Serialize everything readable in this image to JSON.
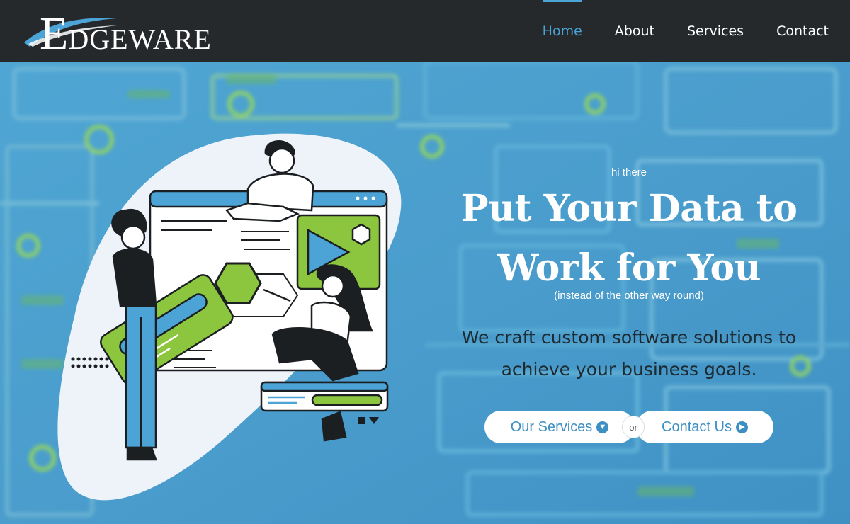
{
  "brand": {
    "logo_initial": "E",
    "logo_rest": "DGEWARE"
  },
  "nav": {
    "items": [
      {
        "label": "Home",
        "active": true
      },
      {
        "label": "About",
        "active": false
      },
      {
        "label": "Services",
        "active": false
      },
      {
        "label": "Contact",
        "active": false
      }
    ]
  },
  "hero": {
    "eyebrow": "hi there",
    "headline_line1": "Put Your Data to",
    "headline_line2": "Work for You",
    "sub_note": "(instead of the other way round)",
    "lead_line1": "We craft custom software solutions to",
    "lead_line2": "achieve your business goals.",
    "cta_primary": "Our Services",
    "cta_divider": "or",
    "cta_secondary": "Contact Us",
    "cta_primary_icon": "chevron-down-circle-icon",
    "cta_secondary_icon": "chevron-right-circle-icon"
  },
  "colors": {
    "header_bg": "#26292c",
    "accent_blue": "#4ba3d6",
    "hero_bg": "#4a9fcf",
    "illustration_green": "#8cc63f",
    "text_dark": "#1e2a30"
  }
}
